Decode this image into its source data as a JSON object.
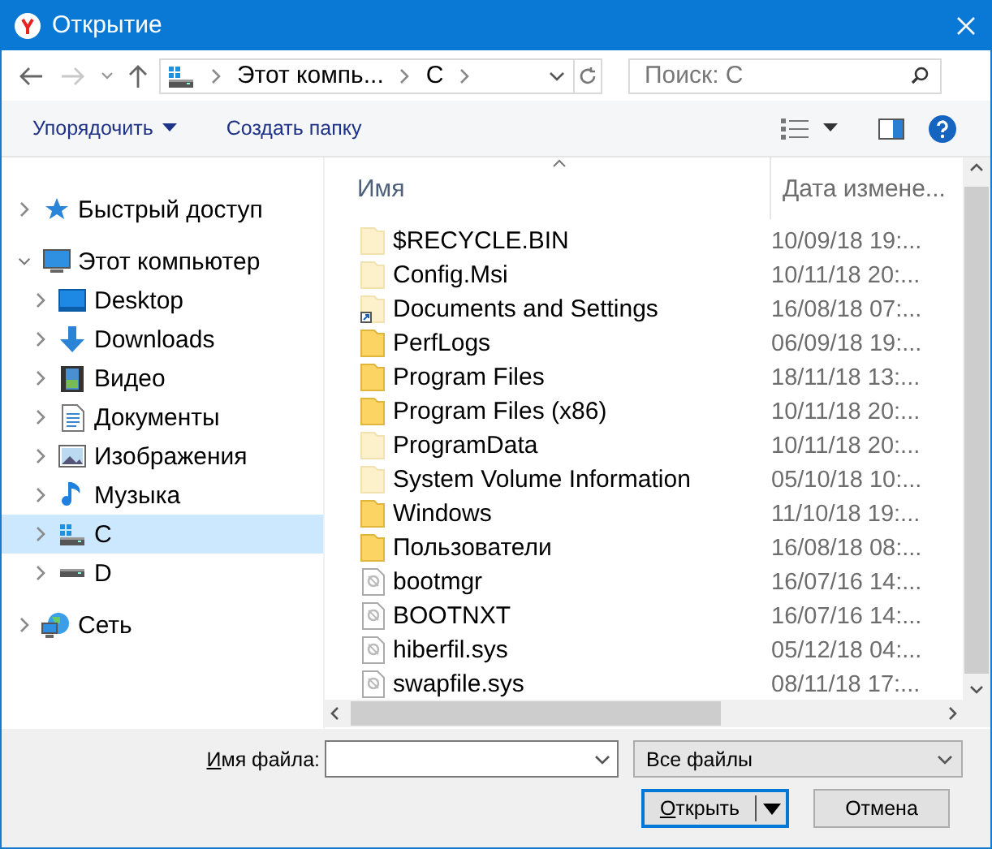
{
  "window": {
    "title": "Открытие"
  },
  "nav": {
    "breadcrumbs": [
      "Этот компь...",
      "C"
    ],
    "search": {
      "placeholder": "Поиск: C"
    }
  },
  "toolbar": {
    "organize": "Упорядочить",
    "new_folder": "Создать папку"
  },
  "sidebar": {
    "items": [
      {
        "label": "Быстрый доступ",
        "kind": "star",
        "expanded": false,
        "selected": false
      },
      {
        "label": "Этот компьютер",
        "kind": "computer",
        "expanded": true,
        "selected": false,
        "children": [
          {
            "label": "Desktop",
            "kind": "desktop",
            "expanded": false,
            "selected": false
          },
          {
            "label": "Downloads",
            "kind": "download",
            "expanded": false,
            "selected": false
          },
          {
            "label": "Видео",
            "kind": "video",
            "expanded": false,
            "selected": false
          },
          {
            "label": "Документы",
            "kind": "document",
            "expanded": false,
            "selected": false
          },
          {
            "label": "Изображения",
            "kind": "picture-folder",
            "expanded": false,
            "selected": false
          },
          {
            "label": "Музыка",
            "kind": "music",
            "expanded": false,
            "selected": false
          },
          {
            "label": "C",
            "kind": "system-drive",
            "expanded": false,
            "selected": true
          },
          {
            "label": "D",
            "kind": "drive",
            "expanded": false,
            "selected": false
          }
        ]
      },
      {
        "label": "Сеть",
        "kind": "network",
        "expanded": false,
        "selected": false
      }
    ]
  },
  "files": {
    "columns": [
      "Имя",
      "Дата измене..."
    ],
    "rows": [
      {
        "name": "$RECYCLE.BIN",
        "date": "10/09/18 19:...",
        "kind": "hidden-folder",
        "selected": false
      },
      {
        "name": "Config.Msi",
        "date": "10/11/18 20:...",
        "kind": "hidden-folder",
        "selected": false
      },
      {
        "name": "Documents and Settings",
        "date": "16/08/18 07:...",
        "kind": "shortcut-folder",
        "selected": false
      },
      {
        "name": "PerfLogs",
        "date": "06/09/18 19:...",
        "kind": "folder",
        "selected": false
      },
      {
        "name": "Program Files",
        "date": "18/11/18 13:...",
        "kind": "folder",
        "selected": false
      },
      {
        "name": "Program Files (x86)",
        "date": "10/11/18 20:...",
        "kind": "folder",
        "selected": false
      },
      {
        "name": "ProgramData",
        "date": "10/11/18 20:...",
        "kind": "hidden-folder",
        "selected": false
      },
      {
        "name": "System Volume Information",
        "date": "05/10/18 10:...",
        "kind": "hidden-folder",
        "selected": false
      },
      {
        "name": "Windows",
        "date": "11/10/18 19:...",
        "kind": "folder",
        "selected": false
      },
      {
        "name": "Пользователи",
        "date": "16/08/18 08:...",
        "kind": "folder",
        "selected": false
      },
      {
        "name": "bootmgr",
        "date": "16/07/16 14:...",
        "kind": "system-file",
        "selected": false
      },
      {
        "name": "BOOTNXT",
        "date": "16/07/16 14:...",
        "kind": "system-file",
        "selected": false
      },
      {
        "name": "hiberfil.sys",
        "date": "05/12/18 04:...",
        "kind": "system-file",
        "selected": false
      },
      {
        "name": "swapfile.sys",
        "date": "08/11/18 17:...",
        "kind": "system-file",
        "selected": false
      }
    ]
  },
  "footer": {
    "filename_label": "Имя файла:",
    "filter": "Все файлы",
    "buttons": [
      {
        "label": "Открыть",
        "default": true
      },
      {
        "label": "Отмена",
        "default": false
      }
    ]
  }
}
